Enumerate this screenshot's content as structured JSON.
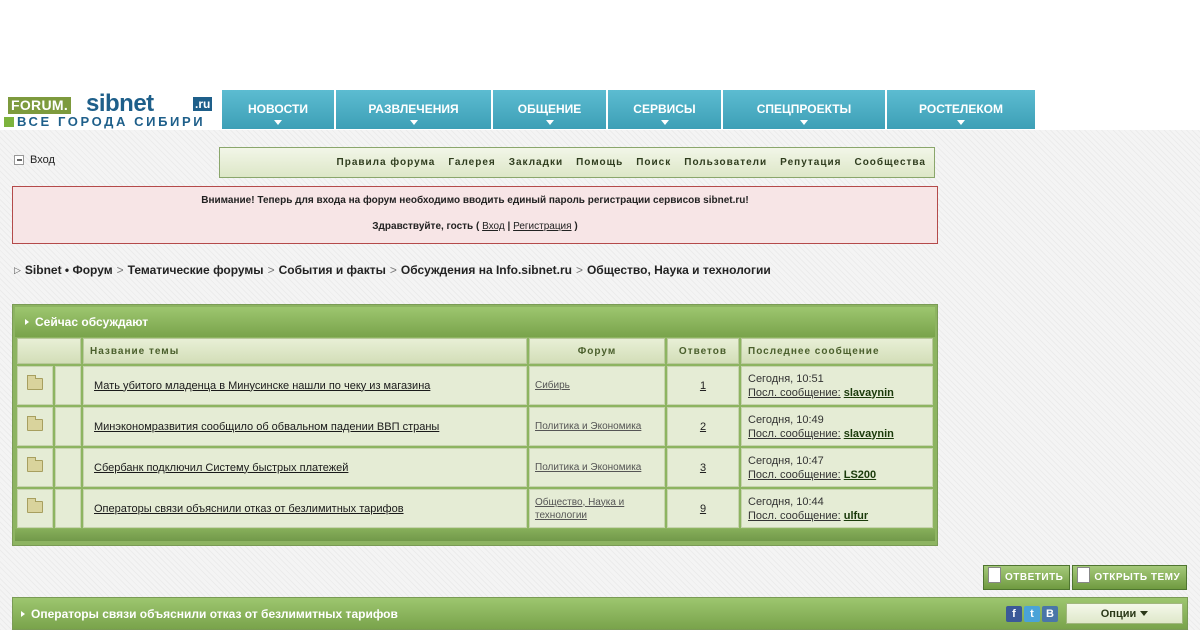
{
  "header": {
    "logo": {
      "forum": "FORUM.",
      "sibnet": "sibnet",
      "ru": ".ru",
      "tagline": "ВСЕ ГОРОДА СИБИРИ"
    },
    "nav": [
      {
        "label": "НОВОСТИ"
      },
      {
        "label": "РАЗВЛЕЧЕНИЯ"
      },
      {
        "label": "ОБЩЕНИЕ"
      },
      {
        "label": "СЕРВИСЫ"
      },
      {
        "label": "СПЕЦПРОЕКТЫ"
      },
      {
        "label": "РОСТЕЛЕКОМ"
      }
    ]
  },
  "login": {
    "label": "Вход"
  },
  "toplinks": [
    "Правила форума",
    "Галерея",
    "Закладки",
    "Помощь",
    "Поиск",
    "Пользователи",
    "Репутация",
    "Сообщества"
  ],
  "notice": {
    "line1": "Внимание! Теперь для входа на форум необходимо вводить единый пароль регистрации сервисов sibnet.ru!",
    "greeting": "Здравствуйте, гость",
    "open_paren": "(",
    "login_link": "Вход",
    "divider": "|",
    "register_link": "Регистрация",
    "close_paren": ")"
  },
  "breadcrumb": {
    "separator": ">",
    "items": [
      "Sibnet • Форум",
      "Тематические форумы",
      "События и факты",
      "Обсуждения на Info.sibnet.ru",
      "Общество, Наука и технологии"
    ]
  },
  "discussed": {
    "title": "Сейчас обсуждают",
    "columns": {
      "topic": "Название темы",
      "forum": "Форум",
      "replies": "Ответов",
      "last": "Последнее сообщение"
    },
    "rows": [
      {
        "title": "Мать убитого младенца в Минусинске нашли по чеку из магазина",
        "forum": "Сибирь",
        "replies": "1",
        "time": "Сегодня, 10:51",
        "last_label": "Посл. сообщение:",
        "user": "slavaynin"
      },
      {
        "title": "Минэкономразвития сообщило об обвальном падении ВВП страны",
        "forum": "Политика и Экономика",
        "replies": "2",
        "time": "Сегодня, 10:49",
        "last_label": "Посл. сообщение:",
        "user": "slavaynin"
      },
      {
        "title": "Сбербанк подключил Систему быстрых платежей",
        "forum": "Политика и Экономика",
        "replies": "3",
        "time": "Сегодня, 10:47",
        "last_label": "Посл. сообщение:",
        "user": "LS200"
      },
      {
        "title": "Операторы связи объяснили отказ от безлимитных тарифов",
        "forum": "Общество, Наука и технологии",
        "replies": "9",
        "time": "Сегодня, 10:44",
        "last_label": "Посл. сообщение:",
        "user": "ulfur"
      }
    ]
  },
  "actions": {
    "reply": "ОТВЕТИТЬ",
    "new_topic": "ОТКРЫТЬ ТЕМУ"
  },
  "thread": {
    "title": "Операторы связи объяснили отказ от безлимитных тарифов",
    "social": [
      {
        "icon": "facebook-icon",
        "glyph": "f",
        "color": "#3b5998"
      },
      {
        "icon": "twitter-icon",
        "glyph": "t",
        "color": "#4aa3d8"
      },
      {
        "icon": "vkontakte-icon",
        "glyph": "В",
        "color": "#4a76a8"
      }
    ],
    "options_label": "Опции"
  },
  "colors": {
    "nav": "#4aaec4",
    "green_bar": "#8db461",
    "notice_bg": "#f7e5e6",
    "notice_border": "#b44a4a"
  }
}
